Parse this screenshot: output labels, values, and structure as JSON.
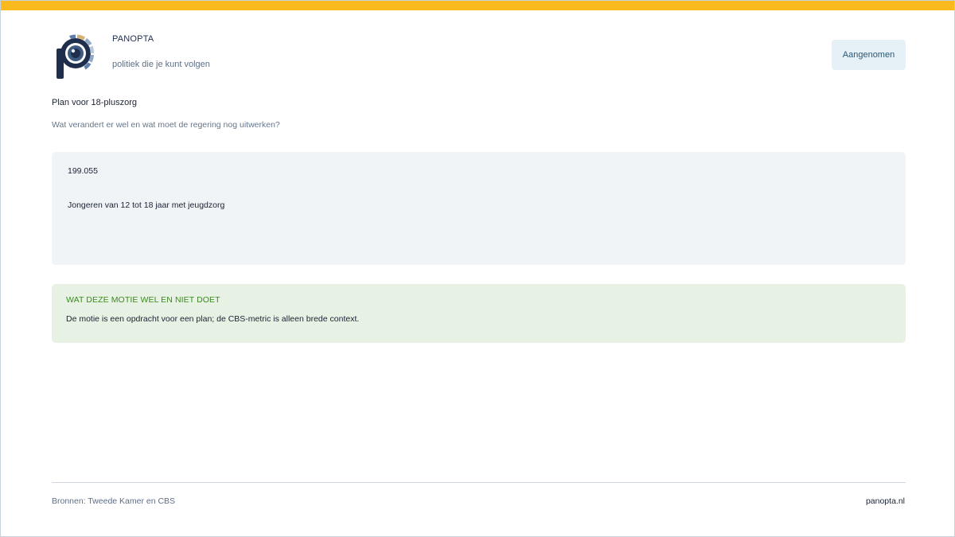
{
  "brand": {
    "name": "PANOPTA",
    "tagline": "politiek die je kunt volgen",
    "logo_icon": "panopta-eye-logo-icon"
  },
  "status": {
    "label": "Aangenomen"
  },
  "motion": {
    "title": "Plan voor 18-pluszorg",
    "subtitle": "Wat verandert er wel en wat moet de regering nog uitwerken?"
  },
  "metric": {
    "value": "199.055",
    "label": "Jongeren van 12 tot 18 jaar met jeugdzorg"
  },
  "note": {
    "heading": "WAT DEZE MOTIE WEL EN NIET DOET",
    "text": "De motie is een opdracht voor een plan; de CBS-metric is alleen brede context."
  },
  "footer": {
    "sources": "Bronnen: Tweede Kamer en CBS",
    "site": "panopta.nl"
  },
  "colors": {
    "accent_bar": "#fbb920",
    "logo_navy": "#1f2e4d",
    "note_heading_green": "#3a8a1f",
    "badge_text": "#255b7a"
  }
}
